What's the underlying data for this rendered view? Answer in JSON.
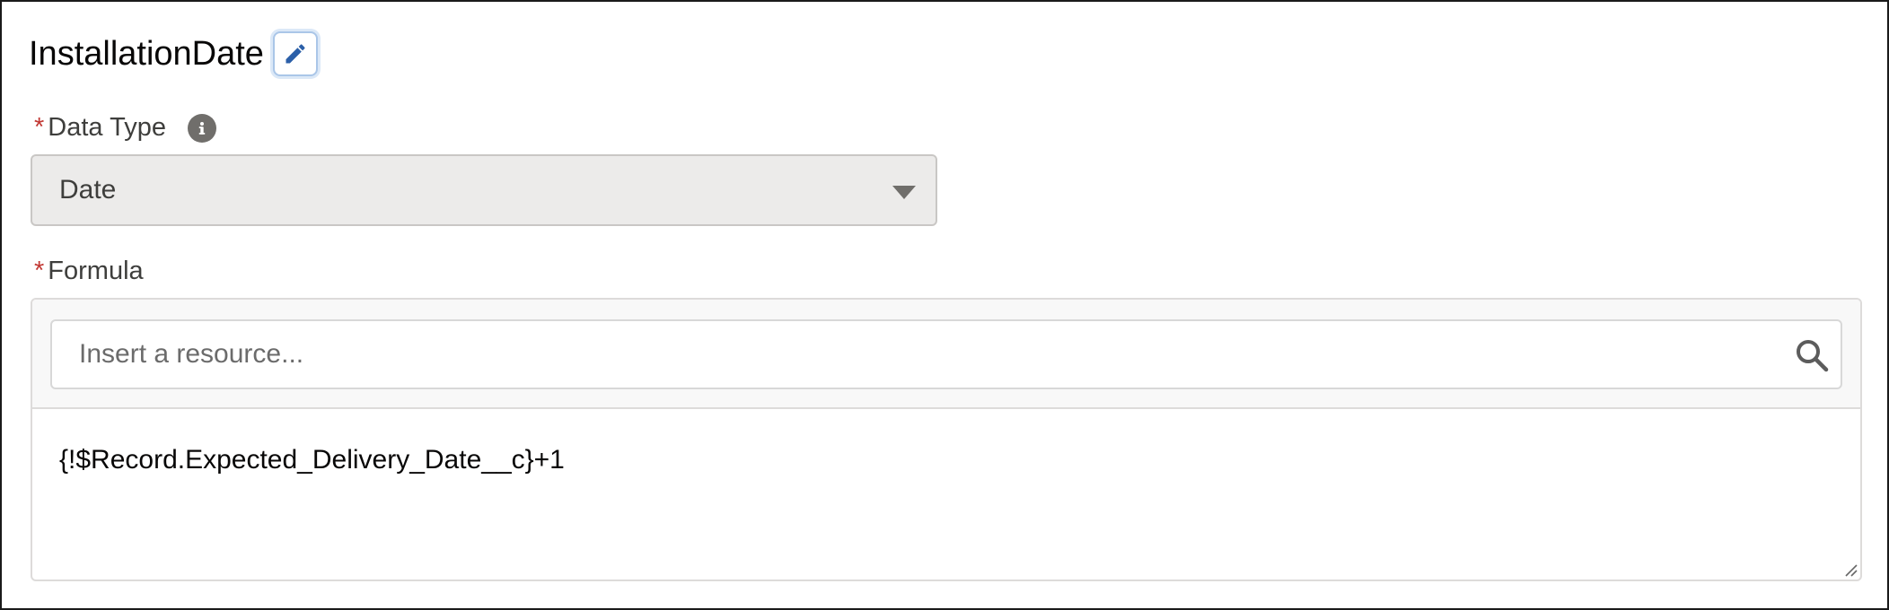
{
  "header": {
    "title": "InstallationDate",
    "edit_icon": "pencil-icon"
  },
  "data_type": {
    "required_marker": "*",
    "label": "Data Type",
    "info_icon": "info-icon",
    "selected_value": "Date"
  },
  "formula": {
    "required_marker": "*",
    "label": "Formula",
    "resource_search": {
      "placeholder": "Insert a resource...",
      "value": "",
      "icon": "search-icon"
    },
    "expression": "{!$Record.Expected_Delivery_Date__c}+1"
  },
  "colors": {
    "required": "#c23934",
    "edit_icon": "#0176d3",
    "select_bg": "#ecebea"
  }
}
